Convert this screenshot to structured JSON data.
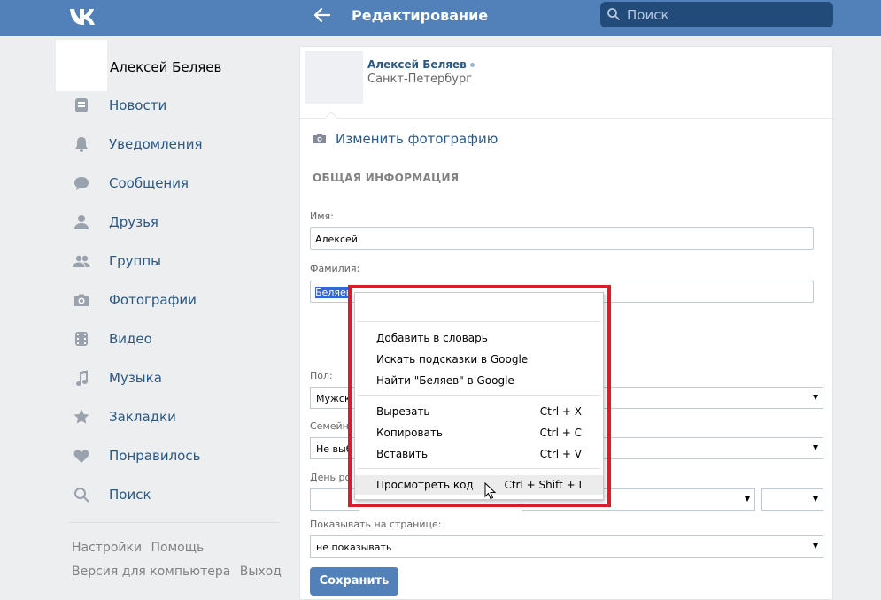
{
  "header": {
    "page_title": "Редактирование",
    "search_placeholder": "Поиск"
  },
  "sidebar": {
    "profile_name": "Алексей Беляев",
    "items": [
      {
        "label": "Новости",
        "icon": "news-icon"
      },
      {
        "label": "Уведомления",
        "icon": "bell-icon"
      },
      {
        "label": "Сообщения",
        "icon": "message-icon"
      },
      {
        "label": "Друзья",
        "icon": "user-icon"
      },
      {
        "label": "Группы",
        "icon": "group-icon"
      },
      {
        "label": "Фотографии",
        "icon": "camera-icon"
      },
      {
        "label": "Видео",
        "icon": "video-icon"
      },
      {
        "label": "Музыка",
        "icon": "music-note-icon"
      },
      {
        "label": "Закладки",
        "icon": "star-icon"
      },
      {
        "label": "Понравилось",
        "icon": "heart-icon"
      },
      {
        "label": "Поиск",
        "icon": "search-icon"
      }
    ],
    "footer": {
      "settings": "Настройки",
      "help": "Помощь",
      "desktop_version": "Версия для компьютера",
      "logout": "Выход"
    }
  },
  "profile_card": {
    "name": "Алексей Беляев",
    "city": "Санкт-Петербург"
  },
  "edit": {
    "change_photo": "Изменить фотографию",
    "section_title": "ОБЩАЯ ИНФОРМАЦИЯ",
    "first_name_label": "Имя:",
    "first_name_value": "Алексей",
    "last_name_label": "Фамилия:",
    "last_name_value": "Беляев",
    "gender_label": "Пол:",
    "gender_value": "Мужск",
    "relationship_label": "Семейн",
    "relationship_value": "Не выб",
    "birthday_label": "День ро",
    "show_on_page_label": "Показывать на странице:",
    "show_on_page_value": "не показывать",
    "save_button": "Сохранить"
  },
  "context_menu": {
    "items": [
      {
        "label": "Добавить в словарь",
        "shortcut": ""
      },
      {
        "label": "Искать подсказки в Google",
        "shortcut": ""
      },
      {
        "label": "Найти \"Беляев\" в Google",
        "shortcut": ""
      },
      {
        "label": "Вырезать",
        "shortcut": "Ctrl + X"
      },
      {
        "label": "Копировать",
        "shortcut": "Ctrl + C"
      },
      {
        "label": "Вставить",
        "shortcut": "Ctrl + V"
      },
      {
        "label": "Просмотреть код",
        "shortcut": "Ctrl + Shift + I"
      }
    ]
  },
  "colors": {
    "header": "#5181b8",
    "link": "#2a5885",
    "highlight_frame": "#d61f2a",
    "selection": "#3367d6"
  }
}
